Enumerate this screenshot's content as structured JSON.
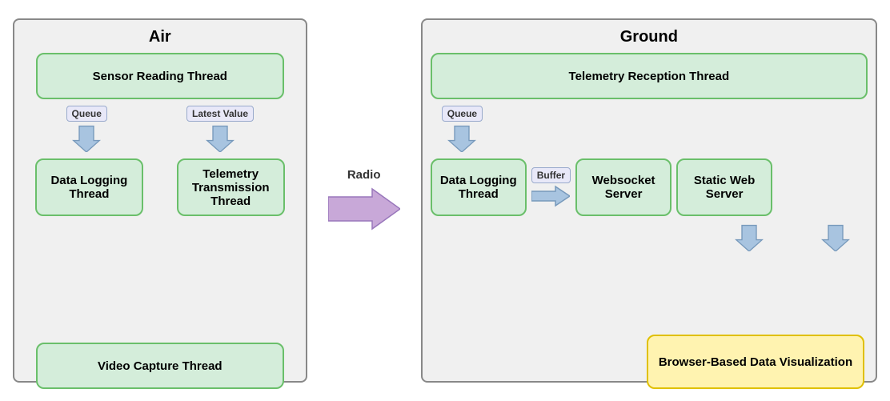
{
  "air_panel": {
    "title": "Air",
    "sensor_reading_thread": "Sensor Reading Thread",
    "data_logging_thread": "Data Logging Thread",
    "telemetry_transmission_thread": "Telemetry Transmission Thread",
    "video_capture_thread": "Video Capture Thread",
    "queue_label": "Queue",
    "latest_value_label": "Latest Value"
  },
  "radio_label": "Radio",
  "ground_panel": {
    "title": "Ground",
    "telemetry_reception_thread": "Telemetry Reception Thread",
    "data_logging_thread": "Data Logging Thread",
    "websocket_server": "Websocket Server",
    "static_web_server": "Static Web Server",
    "browser_based_data_visualization": "Browser-Based Data Visualization",
    "queue_label": "Queue",
    "buffer_label": "Buffer"
  }
}
